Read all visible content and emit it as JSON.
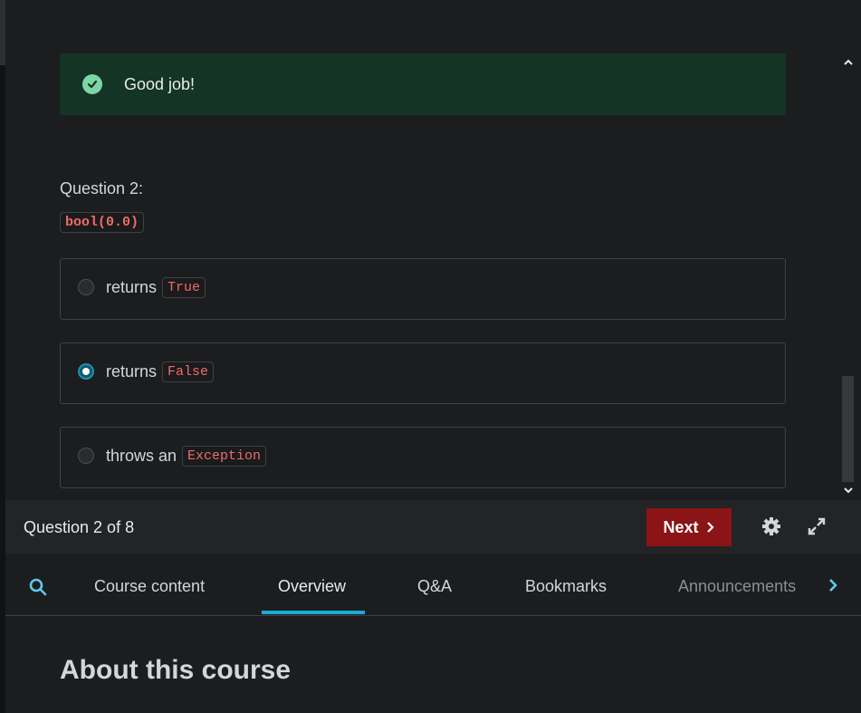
{
  "feedback": {
    "text": "Good job!",
    "icon": "check-circle-icon",
    "color": "#143426"
  },
  "question": {
    "label": "Question 2:",
    "code": "bool(0.0)",
    "options": [
      {
        "prefix": "returns",
        "code": "True",
        "selected": false
      },
      {
        "prefix": "returns",
        "code": "False",
        "selected": true
      },
      {
        "prefix": "throws an",
        "code": "Exception",
        "selected": false
      }
    ]
  },
  "footer": {
    "progress": "Question 2 of 8",
    "next_label": "Next",
    "next_color": "#8b1416"
  },
  "tabs": {
    "items": [
      "Course content",
      "Overview",
      "Q&A",
      "Bookmarks",
      "Announcements"
    ],
    "active": "Overview",
    "accent": "#1aaad6"
  },
  "about": {
    "title": "About this course"
  }
}
